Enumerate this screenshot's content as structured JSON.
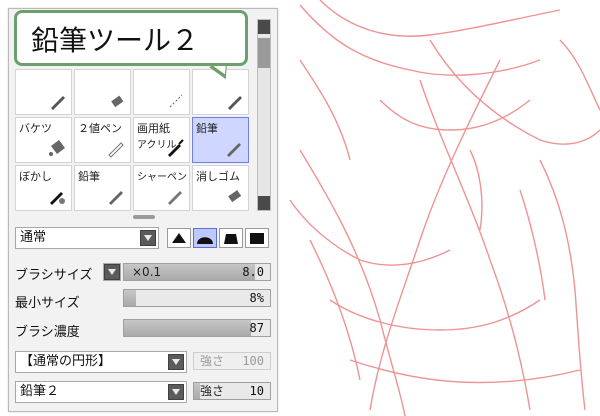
{
  "callout": {
    "title": "鉛筆ツール２"
  },
  "tools": {
    "row1": [
      {
        "label": "",
        "icon": "pencil-icon"
      },
      {
        "label": "",
        "icon": "eraser-icon"
      },
      {
        "label": "",
        "icon": "dotted-pen-icon"
      },
      {
        "label": "",
        "icon": "pencil-icon"
      }
    ],
    "row2": [
      {
        "label": "バケツ",
        "icon": "bucket-icon"
      },
      {
        "label": "２値ペン",
        "icon": "pen-icon"
      },
      {
        "label": "画用紙",
        "sub": "アクリル",
        "icon": "paintbrush-icon"
      },
      {
        "label": "鉛筆",
        "icon": "pencil-icon",
        "selected": true
      }
    ],
    "row3": [
      {
        "label": "ぼかし",
        "icon": "blur-icon"
      },
      {
        "label": "鉛筆",
        "icon": "pencil-icon"
      },
      {
        "label": "シャーペン",
        "icon": "mechanical-pencil-icon"
      },
      {
        "label": "消しゴム",
        "icon": "eraser-icon"
      }
    ]
  },
  "blend": {
    "mode": "通常"
  },
  "brush": {
    "size_label": "ブラシサイズ",
    "size_multiplier": "×0.1",
    "size_value": "8.0",
    "min_size_label": "最小サイズ",
    "min_size_value": "8%",
    "density_label": "ブラシ濃度",
    "density_value": "87",
    "density_fraction": 0.87,
    "min_size_fraction": 0.08,
    "size_fraction": 0.9
  },
  "shape": {
    "selected": "【通常の円形】",
    "strength_label": "強さ",
    "strength_value": "100"
  },
  "texture": {
    "selected": "鉛筆２",
    "strength_label": "強さ",
    "strength_value": "10"
  },
  "colors": {
    "accent": "#6c9f6b",
    "selection": "#cfd6ff",
    "sketch": "#e8706f"
  }
}
